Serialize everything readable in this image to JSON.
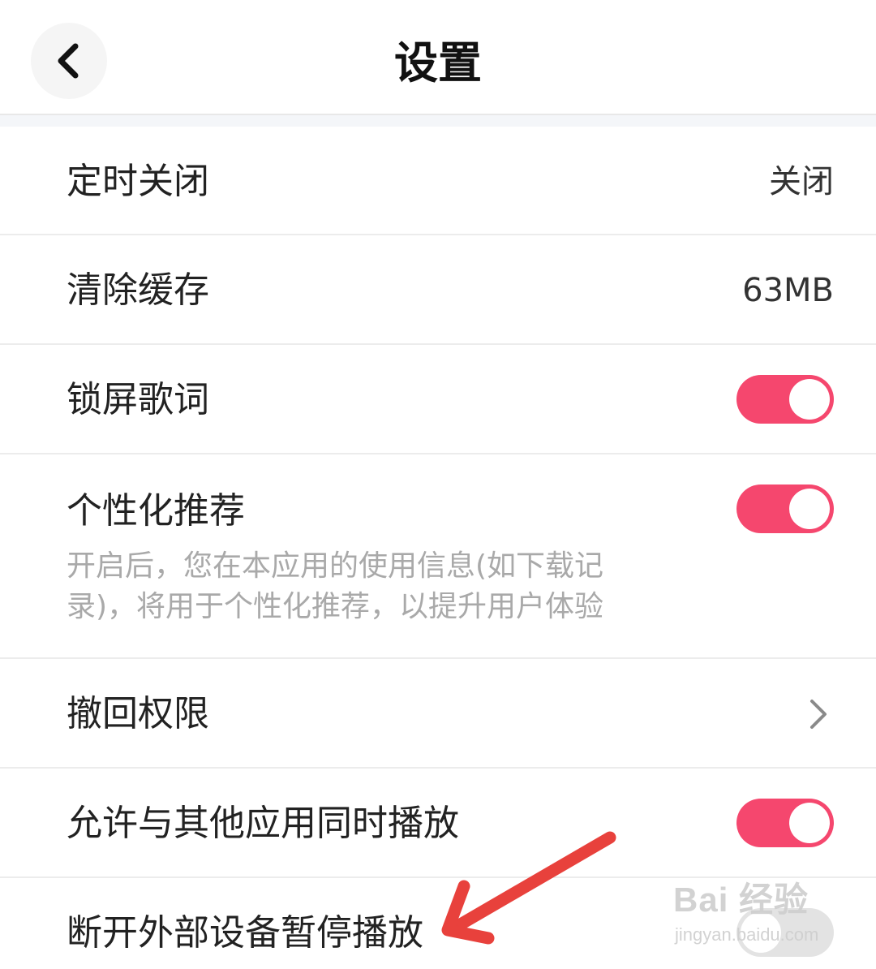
{
  "header": {
    "title": "设置",
    "back_icon": "chevron-left-icon"
  },
  "settings": [
    {
      "label": "定时关闭",
      "value": "关闭"
    },
    {
      "label": "清除缓存",
      "value": "63MB"
    },
    {
      "label": "锁屏歌词",
      "toggle": "on"
    },
    {
      "label": "个性化推荐",
      "toggle": "on",
      "description": "开启后，您在本应用的使用信息(如下载记录)，将用于个性化推荐，以提升用户体验"
    },
    {
      "label": "撤回权限",
      "chevron_icon": "chevron-right-icon"
    },
    {
      "label": "允许与其他应用同时播放",
      "toggle": "on"
    },
    {
      "label": "断开外部设备暂停播放",
      "toggle": "off"
    }
  ],
  "watermark": {
    "main": "Bai 经验",
    "sub": "jingyan.baidu.com"
  },
  "colors": {
    "accent": "#f5476e",
    "annotation_arrow": "#e8413c"
  }
}
